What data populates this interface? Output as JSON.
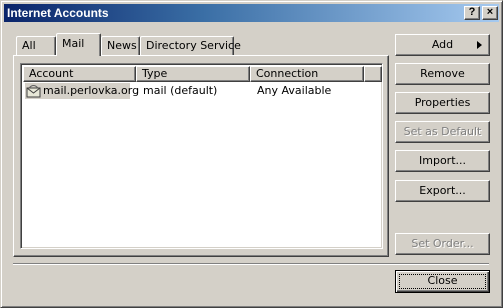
{
  "window": {
    "title": "Internet Accounts",
    "help_glyph": "?",
    "close_glyph": "×"
  },
  "tabs": [
    {
      "label": "All",
      "selected": false
    },
    {
      "label": "Mail",
      "selected": true
    },
    {
      "label": "News",
      "selected": false
    },
    {
      "label": "Directory Service",
      "selected": false
    }
  ],
  "list": {
    "columns": [
      "Account",
      "Type",
      "Connection"
    ],
    "rows": [
      {
        "icon": "mail-server-icon",
        "account": "mail.perlovka.org",
        "type": "mail (default)",
        "connection": "Any Available",
        "selected": true
      }
    ]
  },
  "buttons": {
    "add": {
      "label": "Add",
      "enabled": true
    },
    "remove": {
      "label": "Remove",
      "enabled": true
    },
    "properties": {
      "label": "Properties",
      "enabled": true
    },
    "set_default": {
      "label": "Set as Default",
      "enabled": false
    },
    "import": {
      "label": "Import...",
      "enabled": true
    },
    "export": {
      "label": "Export...",
      "enabled": true
    },
    "set_order": {
      "label": "Set Order...",
      "enabled": false
    },
    "close": {
      "label": "Close",
      "enabled": true
    }
  },
  "colors": {
    "face": "#d4d0c8",
    "title_start": "#0a246a",
    "title_end": "#a6caf0",
    "disabled_text": "#808080"
  }
}
